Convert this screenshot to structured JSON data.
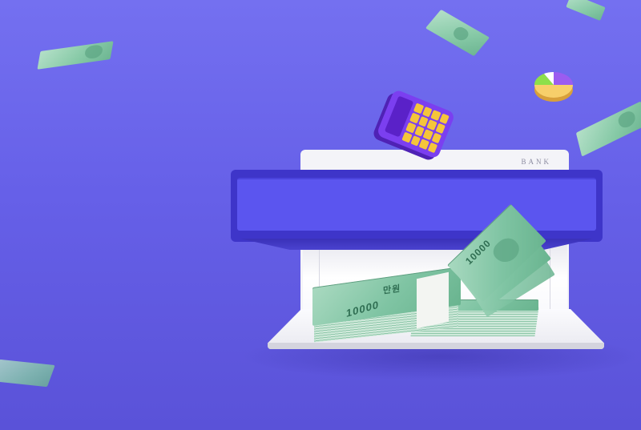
{
  "machine": {
    "label": "BANK"
  },
  "money": {
    "stack_label": "10000",
    "stack_unit": "만원",
    "top_bill_label": "10000"
  },
  "colors": {
    "background_top": "#7470f0",
    "background_bottom": "#5a52d8",
    "machine_slot": "#3e35c9",
    "slot_inner": "#5b55ef",
    "bill_green": "#86c9a6",
    "calculator": "#7b3ff0",
    "calculator_keys": "#f5c53a"
  },
  "icons": {
    "calculator": "calculator-icon",
    "pie_chart": "pie-chart-icon",
    "banknote": "banknote-icon"
  }
}
